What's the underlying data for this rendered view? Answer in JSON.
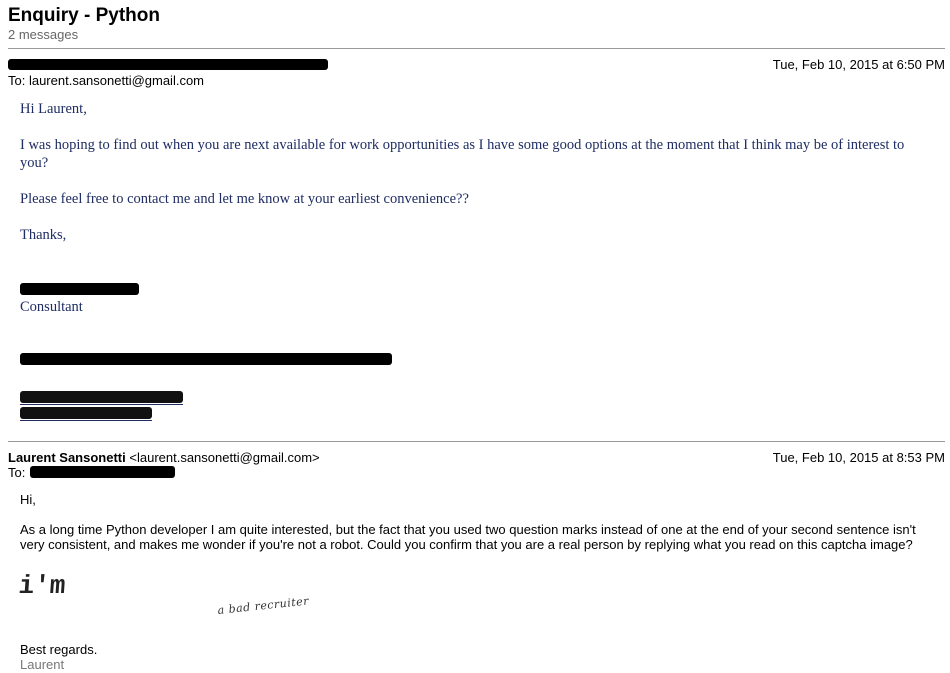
{
  "thread": {
    "subject": "Enquiry - Python",
    "message_count": "2 messages"
  },
  "message1": {
    "date": "Tue, Feb 10, 2015 at 6:50 PM",
    "to_label": "To: laurent.sansonetti@gmail.com",
    "greeting": "Hi Laurent,",
    "para1": "I was hoping to find out when you are next available for work opportunities as I have some good options at the moment that I think may be of interest to you?",
    "para2": "Please feel free to contact me and let me know at your earliest convenience??",
    "thanks": "Thanks,",
    "signature_role": "Consultant"
  },
  "message2": {
    "from_name": "Laurent Sansonetti",
    "from_email": "<laurent.sansonetti@gmail.com>",
    "date": "Tue, Feb 10, 2015 at 8:53 PM",
    "to_label": "To:",
    "greeting": "Hi,",
    "para1": "As a long time Python developer I am quite interested, but the fact that you used two question marks instead of one at the end of your second sentence isn't very consistent, and makes me wonder if you're not a robot. Could you confirm that you are a real person by replying what you read on this captcha image?",
    "captcha_word1": "i'm",
    "captcha_word2": "a bad recruiter",
    "closing": "Best regards.",
    "signature": "Laurent"
  }
}
